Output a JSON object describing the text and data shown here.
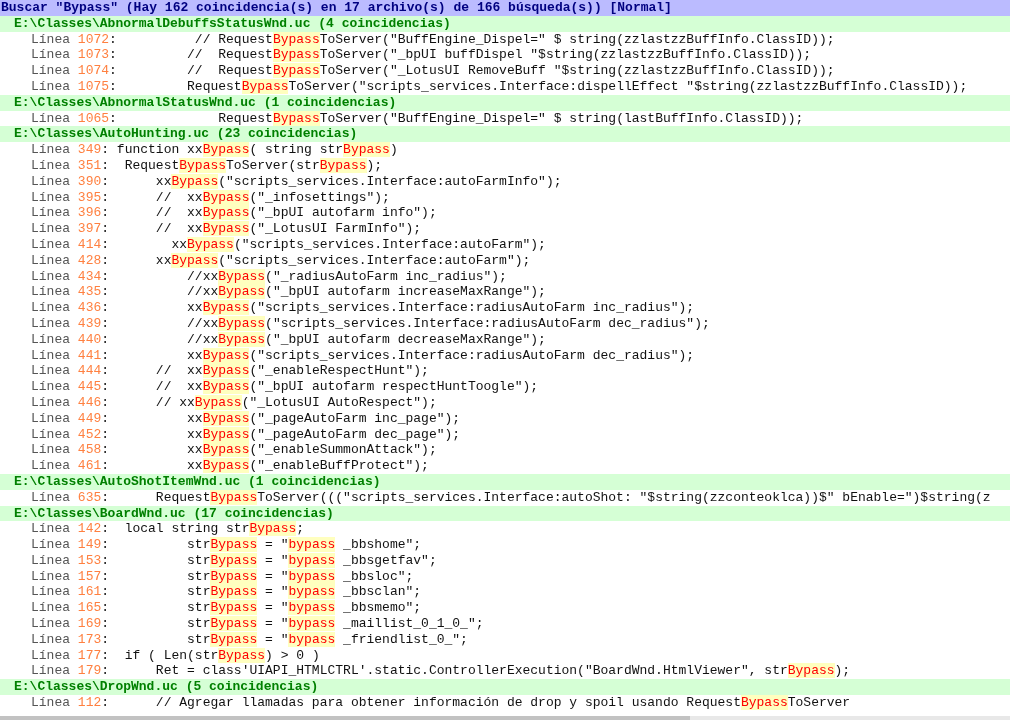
{
  "search_header": "Buscar \"Bypass\" (Hay 162 coincidencia(s) en 17 archivo(s) de 166 búsqueda(s)) [Normal]",
  "files": [
    {
      "header": "E:\\Classes\\AbnormalDebuffsStatusWnd.uc (4 coincidencias)",
      "lines": [
        {
          "label": "Línea",
          "number": "1072",
          "parts": [
            ":          // Request",
            "Bypass",
            "ToServer(\"BuffEngine_Dispel=\" $ string(zzlastzzBuffInfo.ClassID));"
          ]
        },
        {
          "label": "Línea",
          "number": "1073",
          "parts": [
            ":         //  Request",
            "Bypass",
            "ToServer(\"_bpUI buffDispel \"$string(zzlastzzBuffInfo.ClassID));"
          ]
        },
        {
          "label": "Línea",
          "number": "1074",
          "parts": [
            ":         //  Request",
            "Bypass",
            "ToServer(\"_LotusUI RemoveBuff \"$string(zzlastzzBuffInfo.ClassID));"
          ]
        },
        {
          "label": "Línea",
          "number": "1075",
          "parts": [
            ":         Request",
            "Bypass",
            "ToServer(\"scripts_services.Interface:dispellEffect \"$string(zzlastzzBuffInfo.ClassID));"
          ]
        }
      ]
    },
    {
      "header": "E:\\Classes\\AbnormalStatusWnd.uc (1 coincidencias)",
      "lines": [
        {
          "label": "Línea",
          "number": "1065",
          "parts": [
            ":             Request",
            "Bypass",
            "ToServer(\"BuffEngine_Dispel=\" $ string(lastBuffInfo.ClassID));"
          ]
        }
      ]
    },
    {
      "header": "E:\\Classes\\AutoHunting.uc (23 coincidencias)",
      "lines": [
        {
          "label": "Línea",
          "number": "349",
          "parts": [
            ": function xx",
            "Bypass",
            "( string str",
            "Bypass",
            ")"
          ]
        },
        {
          "label": "Línea",
          "number": "351",
          "parts": [
            ":  Request",
            "Bypass",
            "ToServer(str",
            "Bypass",
            ");"
          ]
        },
        {
          "label": "Línea",
          "number": "390",
          "parts": [
            ":      xx",
            "Bypass",
            "(\"scripts_services.Interface:autoFarmInfo\");"
          ]
        },
        {
          "label": "Línea",
          "number": "395",
          "parts": [
            ":      //  xx",
            "Bypass",
            "(\"_infosettings\");"
          ]
        },
        {
          "label": "Línea",
          "number": "396",
          "parts": [
            ":      //  xx",
            "Bypass",
            "(\"_bpUI autofarm info\");"
          ]
        },
        {
          "label": "Línea",
          "number": "397",
          "parts": [
            ":      //  xx",
            "Bypass",
            "(\"_LotusUI FarmInfo\");"
          ]
        },
        {
          "label": "Línea",
          "number": "414",
          "parts": [
            ":        xx",
            "Bypass",
            "(\"scripts_services.Interface:autoFarm\");"
          ]
        },
        {
          "label": "Línea",
          "number": "428",
          "parts": [
            ":      xx",
            "Bypass",
            "(\"scripts_services.Interface:autoFarm\");"
          ]
        },
        {
          "label": "Línea",
          "number": "434",
          "parts": [
            ":          //xx",
            "Bypass",
            "(\"_radiusAutoFarm inc_radius\");"
          ]
        },
        {
          "label": "Línea",
          "number": "435",
          "parts": [
            ":          //xx",
            "Bypass",
            "(\"_bpUI autofarm increaseMaxRange\");"
          ]
        },
        {
          "label": "Línea",
          "number": "436",
          "parts": [
            ":          xx",
            "Bypass",
            "(\"scripts_services.Interface:radiusAutoFarm inc_radius\");"
          ]
        },
        {
          "label": "Línea",
          "number": "439",
          "parts": [
            ":          //xx",
            "Bypass",
            "(\"scripts_services.Interface:radiusAutoFarm dec_radius\");"
          ]
        },
        {
          "label": "Línea",
          "number": "440",
          "parts": [
            ":          //xx",
            "Bypass",
            "(\"_bpUI autofarm decreaseMaxRange\");"
          ]
        },
        {
          "label": "Línea",
          "number": "441",
          "parts": [
            ":          xx",
            "Bypass",
            "(\"scripts_services.Interface:radiusAutoFarm dec_radius\");"
          ]
        },
        {
          "label": "Línea",
          "number": "444",
          "parts": [
            ":      //  xx",
            "Bypass",
            "(\"_enableRespectHunt\");"
          ]
        },
        {
          "label": "Línea",
          "number": "445",
          "parts": [
            ":      //  xx",
            "Bypass",
            "(\"_bpUI autofarm respectHuntToogle\");"
          ]
        },
        {
          "label": "Línea",
          "number": "446",
          "parts": [
            ":      // xx",
            "Bypass",
            "(\"_LotusUI AutoRespect\");"
          ]
        },
        {
          "label": "Línea",
          "number": "449",
          "parts": [
            ":          xx",
            "Bypass",
            "(\"_pageAutoFarm inc_page\");"
          ]
        },
        {
          "label": "Línea",
          "number": "452",
          "parts": [
            ":          xx",
            "Bypass",
            "(\"_pageAutoFarm dec_page\");"
          ]
        },
        {
          "label": "Línea",
          "number": "458",
          "parts": [
            ":          xx",
            "Bypass",
            "(\"_enableSummonAttack\");"
          ]
        },
        {
          "label": "Línea",
          "number": "461",
          "parts": [
            ":          xx",
            "Bypass",
            "(\"_enableBuffProtect\");"
          ]
        }
      ]
    },
    {
      "header": "E:\\Classes\\AutoShotItemWnd.uc (1 coincidencias)",
      "lines": [
        {
          "label": "Línea",
          "number": "635",
          "parts": [
            ":      Request",
            "Bypass",
            "ToServer(((\"scripts_services.Interface:autoShot: \"$string(zzconteoklca))$\" bEnable=\")$string(z"
          ]
        }
      ]
    },
    {
      "header": "E:\\Classes\\BoardWnd.uc (17 coincidencias)",
      "lines": [
        {
          "label": "Línea",
          "number": "142",
          "parts": [
            ":  local string str",
            "Bypass",
            ";"
          ]
        },
        {
          "label": "Línea",
          "number": "149",
          "parts": [
            ":          str",
            "Bypass",
            " = \"",
            "bypass",
            " _bbshome\";"
          ]
        },
        {
          "label": "Línea",
          "number": "153",
          "parts": [
            ":          str",
            "Bypass",
            " = \"",
            "bypass",
            " _bbsgetfav\";"
          ]
        },
        {
          "label": "Línea",
          "number": "157",
          "parts": [
            ":          str",
            "Bypass",
            " = \"",
            "bypass",
            " _bbsloc\";"
          ]
        },
        {
          "label": "Línea",
          "number": "161",
          "parts": [
            ":          str",
            "Bypass",
            " = \"",
            "bypass",
            " _bbsclan\";"
          ]
        },
        {
          "label": "Línea",
          "number": "165",
          "parts": [
            ":          str",
            "Bypass",
            " = \"",
            "bypass",
            " _bbsmemo\";"
          ]
        },
        {
          "label": "Línea",
          "number": "169",
          "parts": [
            ":          str",
            "Bypass",
            " = \"",
            "bypass",
            " _maillist_0_1_0_\";"
          ]
        },
        {
          "label": "Línea",
          "number": "173",
          "parts": [
            ":          str",
            "Bypass",
            " = \"",
            "bypass",
            " _friendlist_0_\";"
          ]
        },
        {
          "label": "Línea",
          "number": "177",
          "parts": [
            ":  if ( Len(str",
            "Bypass",
            ") > 0 )"
          ]
        },
        {
          "label": "Línea",
          "number": "179",
          "parts": [
            ":      Ret = class'UIAPI_HTMLCTRL'.static.ControllerExecution(\"BoardWnd.HtmlViewer\", str",
            "Bypass",
            ");"
          ]
        }
      ]
    },
    {
      "header": "E:\\Classes\\DropWnd.uc (5 coincidencias)",
      "lines": [
        {
          "label": "Línea",
          "number": "112",
          "parts": [
            ":      // Agregar llamadas para obtener información de drop y spoil usando Request",
            "Bypass",
            "ToServer"
          ]
        }
      ]
    }
  ]
}
